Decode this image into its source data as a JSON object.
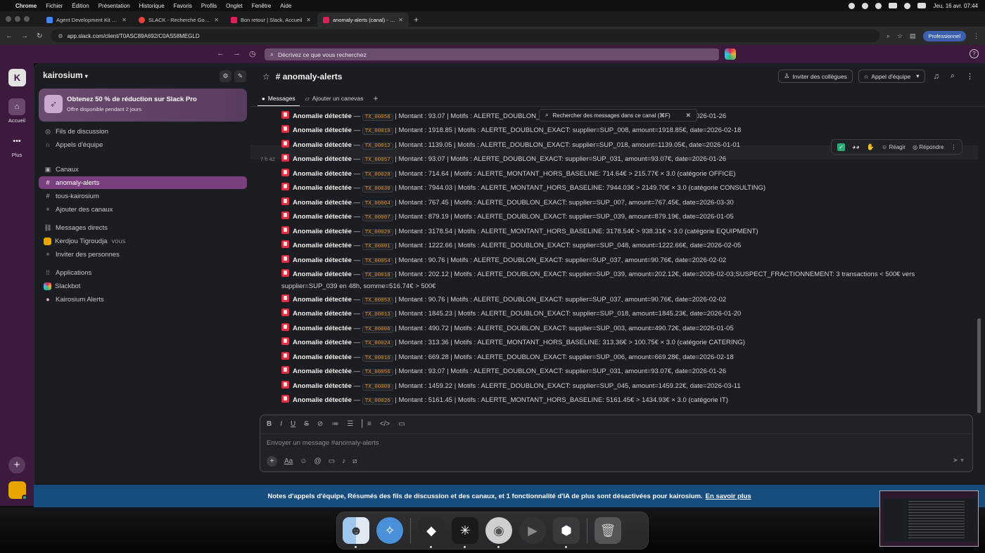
{
  "menubar": {
    "app": "Chrome",
    "items": [
      "Fichier",
      "Édition",
      "Présentation",
      "Historique",
      "Favoris",
      "Profils",
      "Onglet",
      "Fenêtre",
      "Aide"
    ],
    "clock": "Jeu. 16 avr.  07:44"
  },
  "browser": {
    "tabs": [
      {
        "title": "Agent Development Kit Dev U",
        "color": "#4285f4"
      },
      {
        "title": "SLACK - Recherche Google",
        "color": "#ea4335"
      },
      {
        "title": "Bon retour | Slack, Accueil",
        "color": "#e01e5a"
      },
      {
        "title": "anomaly-alerts (canal) - kair",
        "color": "#e01e5a"
      }
    ],
    "url": "app.slack.com/client/T0ASC89A692/C0AS58MEGLD",
    "profile": "Professionnel"
  },
  "slack_top": {
    "search_placeholder": "Décrivez ce que vous recherchez"
  },
  "rail": {
    "workspace_initial": "K",
    "home_label": "Accueil",
    "more_label": "Plus"
  },
  "sidebar": {
    "workspace": "kairosium",
    "promo_title": "Obtenez 50 % de réduction sur Slack Pro",
    "promo_sub": "Offre disponible pendant 2 jours",
    "threads": "Fils de discussion",
    "huddles": "Appels d'équipe",
    "channels_header": "Canaux",
    "channels": [
      "anomaly-alerts",
      "tous-kairosium"
    ],
    "add_channels": "Ajouter des canaux",
    "dm_header": "Messages directs",
    "dm_user": "Kerdjou Tigroudja",
    "dm_you": "vous",
    "invite_people": "Inviter des personnes",
    "apps_header": "Applications",
    "apps": [
      "Slackbot",
      "Kairosium Alerts"
    ]
  },
  "channel": {
    "name": "# anomaly-alerts",
    "invite_btn": "Inviter des collègues",
    "huddle_btn": "Appel d'équipe",
    "tab_messages": "Messages",
    "tab_canvas": "Ajouter un canevas",
    "search_in_channel": "Rechercher des messages dans ce canal (⌘F)",
    "timestamp": "7 h 42",
    "reactions": {
      "react": "Réagir",
      "reply": "Répondre"
    }
  },
  "messages": [
    {
      "label": "Anomalie détectée",
      "sep": " — ",
      "tx": "TX_00058",
      "rest": " | Montant : 93.07 | Motifs : ALERTE_DOUBLON_EXACT: supplier=SUP_031, amount=93.07€, date=2026-01-26"
    },
    {
      "label": "Anomalie détectée",
      "sep": " — ",
      "tx": "TX_00019",
      "rest": " | Montant : 1918.85 | Motifs : ALERTE_DOUBLON_EXACT: supplier=SUP_008, amount=1918.85€, date=2026-02-18"
    },
    {
      "label": "Anomalie détectée",
      "sep": " — ",
      "tx": "TX_00012",
      "rest": " | Montant : 1139.05 | Motifs : ALERTE_DOUBLON_EXACT: supplier=SUP_018, amount=1139.05€, date=2026-01-01"
    },
    {
      "label": "Anomalie détectée",
      "sep": " — ",
      "tx": "TX_00057",
      "rest": " | Montant : 93.07 | Motifs : ALERTE_DOUBLON_EXACT: supplier=SUP_031, amount=93.07€, date=2026-01-26"
    },
    {
      "label": "Anomalie détectée",
      "sep": " — ",
      "tx": "TX_00028",
      "rest": " | Montant : 714.64 | Motifs : ALERTE_MONTANT_HORS_BASELINE: 714.64€ > 215.77€ × 3.0 (catégorie OFFICE)"
    },
    {
      "label": "Anomalie détectée",
      "sep": " — ",
      "tx": "TX_00030",
      "rest": " | Montant : 7944.03 | Motifs : ALERTE_MONTANT_HORS_BASELINE: 7944.03€ > 2149.70€ × 3.0 (catégorie CONSULTING)"
    },
    {
      "label": "Anomalie détectée",
      "sep": " — ",
      "tx": "TX_00004",
      "rest": " | Montant : 767.45 | Motifs : ALERTE_DOUBLON_EXACT: supplier=SUP_007, amount=767.45€, date=2026-03-30"
    },
    {
      "label": "Anomalie détectée",
      "sep": " — ",
      "tx": "TX_00007",
      "rest": " | Montant : 879.19 | Motifs : ALERTE_DOUBLON_EXACT: supplier=SUP_039, amount=879.19€, date=2026-01-05"
    },
    {
      "label": "Anomalie détectée",
      "sep": " — ",
      "tx": "TX_00029",
      "rest": " | Montant : 3178.54 | Motifs : ALERTE_MONTANT_HORS_BASELINE: 3178.54€ > 938.31€ × 3.0 (catégorie EQUIPMENT)"
    },
    {
      "label": "Anomalie détectée",
      "sep": " — ",
      "tx": "TX_00001",
      "rest": " | Montant : 1222.66 | Motifs : ALERTE_DOUBLON_EXACT: supplier=SUP_048, amount=1222.66€, date=2026-02-05"
    },
    {
      "label": "Anomalie détectée",
      "sep": " — ",
      "tx": "TX_00054",
      "rest": " | Montant : 90.76 | Motifs : ALERTE_DOUBLON_EXACT: supplier=SUP_037, amount=90.76€, date=2026-02-02"
    },
    {
      "label": "Anomalie détectée",
      "sep": " — ",
      "tx": "TX_00018",
      "rest": " | Montant : 202.12 | Motifs : ALERTE_DOUBLON_EXACT: supplier=SUP_039, amount=202.12€, date=2026-02-03;SUSPECT_FRACTIONNEMENT: 3 transactions < 500€ vers supplier=SUP_039 en 48h, somme=516.74€ > 500€"
    },
    {
      "label": "Anomalie détectée",
      "sep": " — ",
      "tx": "TX_00053",
      "rest": " | Montant : 90.76 | Motifs : ALERTE_DOUBLON_EXACT: supplier=SUP_037, amount=90.76€, date=2026-02-02"
    },
    {
      "label": "Anomalie détectée",
      "sep": " — ",
      "tx": "TX_00013",
      "rest": " | Montant : 1845.23 | Motifs : ALERTE_DOUBLON_EXACT: supplier=SUP_018, amount=1845.23€, date=2026-01-20"
    },
    {
      "label": "Anomalie détectée",
      "sep": " — ",
      "tx": "TX_00006",
      "rest": " | Montant : 490.72 | Motifs : ALERTE_DOUBLON_EXACT: supplier=SUP_003, amount=490.72€, date=2026-01-05"
    },
    {
      "label": "Anomalie détectée",
      "sep": " — ",
      "tx": "TX_00024",
      "rest": " | Montant : 313.36 | Motifs : ALERTE_MONTANT_HORS_BASELINE: 313.36€ > 100.75€ × 3.0 (catégorie CATERING)"
    },
    {
      "label": "Anomalie détectée",
      "sep": " — ",
      "tx": "TX_00016",
      "rest": " | Montant : 669.28 | Motifs : ALERTE_DOUBLON_EXACT: supplier=SUP_006, amount=669.28€, date=2026-02-18"
    },
    {
      "label": "Anomalie détectée",
      "sep": " — ",
      "tx": "TX_00056",
      "rest": " | Montant : 93.07 | Motifs : ALERTE_DOUBLON_EXACT: supplier=SUP_031, amount=93.07€, date=2026-01-26"
    },
    {
      "label": "Anomalie détectée",
      "sep": " — ",
      "tx": "TX_00009",
      "rest": " | Montant : 1459.22 | Motifs : ALERTE_DOUBLON_EXACT: supplier=SUP_045, amount=1459.22€, date=2026-03-11"
    },
    {
      "label": "Anomalie détectée",
      "sep": " — ",
      "tx": "TX_00026",
      "rest": " | Montant : 5161.45 | Motifs : ALERTE_MONTANT_HORS_BASELINE: 5161.45€ > 1434.93€ × 3.0 (catégorie IT)"
    }
  ],
  "composer": {
    "placeholder": "Envoyer un message #anomaly-alerts"
  },
  "notice": {
    "text": "Notes d'appels d'équipe, Résumés des fils de discussion et des canaux, et 1 fonctionnalité d'IA de plus sont désactivées pour kairosium.",
    "link": "En savoir plus"
  }
}
